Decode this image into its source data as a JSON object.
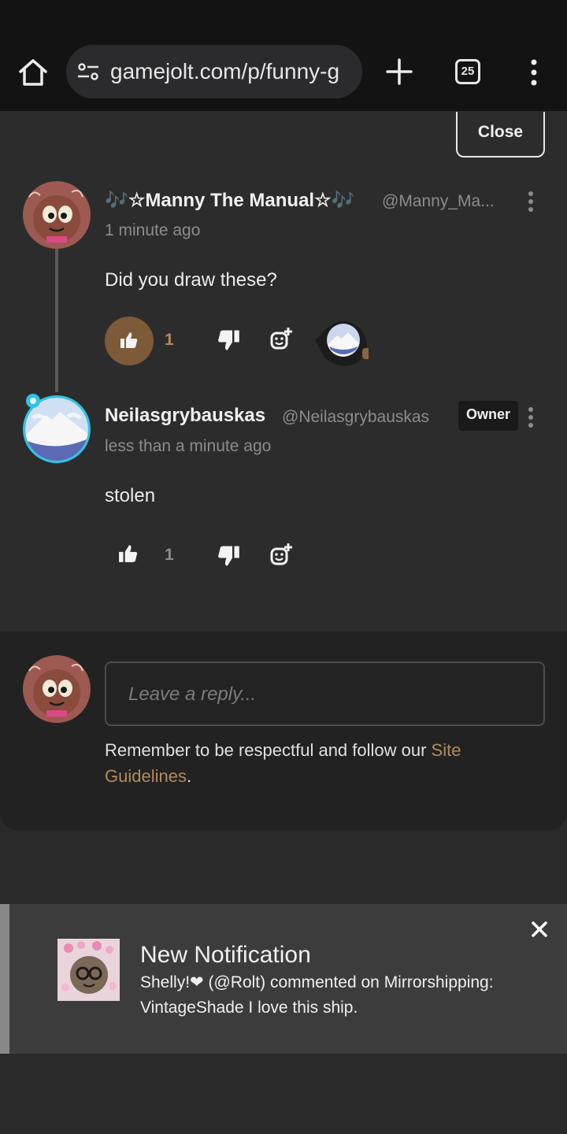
{
  "browser": {
    "url": "gamejolt.com/p/funny-g",
    "tab_count": "25",
    "icons": [
      "home-icon",
      "site-settings-icon",
      "new-tab-icon",
      "tab-switcher-icon",
      "more-menu-icon"
    ]
  },
  "panel": {
    "close_label": "Close"
  },
  "comments": [
    {
      "display_name": "🎶☆Manny The Manual☆🎶",
      "handle": "@Manny_Ma...",
      "time": "1 minute ago",
      "body": "Did you draw these?",
      "like_count": "1",
      "liked": true
    },
    {
      "display_name": "Neilasgrybauskas",
      "handle": "@Neilasgrybauskas",
      "badge": "Owner",
      "time": "less than a minute ago",
      "body": "stolen",
      "like_count": "1",
      "liked": false
    }
  ],
  "reply": {
    "placeholder": "Leave a reply...",
    "guidelines_prefix": "Remember to be respectful and follow our ",
    "guidelines_link": "Site Guidelines",
    "guidelines_suffix": "."
  },
  "notification": {
    "title": "New Notification",
    "text": "Shelly!❤ (@Rolt) commented on Mirrorshipping: VintageShade I love this ship."
  },
  "colors": {
    "accent": "#b58a58",
    "liked_background": "#7d5a38"
  }
}
